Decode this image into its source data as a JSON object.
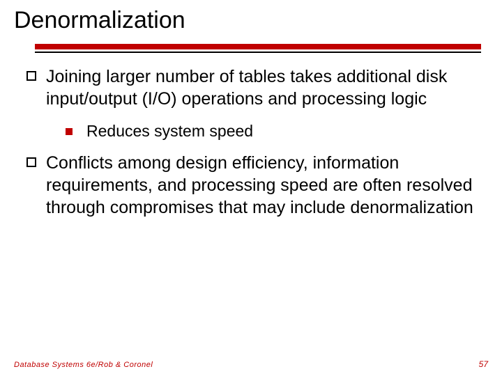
{
  "title": "Denormalization",
  "bullets": [
    {
      "text": "Joining larger number of tables takes additional disk input/output (I/O) operations and processing logic",
      "sub": [
        "Reduces system speed"
      ]
    },
    {
      "text": "Conflicts among design efficiency, information requirements, and processing speed are often resolved through compromises that may include denormalization",
      "sub": []
    }
  ],
  "footer": {
    "source": "Database Systems 6e/Rob & Coronel",
    "page": "57"
  },
  "colors": {
    "accent": "#c00000",
    "text": "#000000",
    "background": "#ffffff"
  }
}
